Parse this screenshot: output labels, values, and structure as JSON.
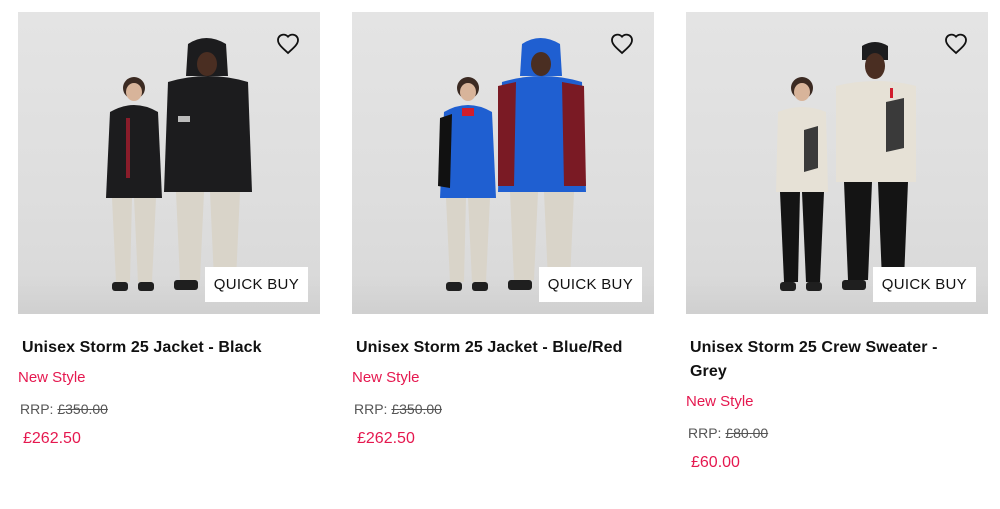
{
  "products": [
    {
      "name": "Unisex Storm 25 Jacket - Black",
      "badge": "New Style",
      "rrp_label": "RRP:",
      "rrp_price": "£350.00",
      "price": "£262.50",
      "quick_buy_label": "QUICK BUY",
      "wishlist_icon": "heart-outline-icon",
      "colors": {
        "jacket": "#1c1c1e",
        "accent": "#8a1c2a",
        "pants": "#d9d4c9",
        "top": "#1c1c1e"
      }
    },
    {
      "name": "Unisex Storm 25 Jacket - Blue/Red",
      "badge": "New Style",
      "rrp_label": "RRP:",
      "rrp_price": "£350.00",
      "price": "£262.50",
      "quick_buy_label": "QUICK BUY",
      "wishlist_icon": "heart-outline-icon",
      "colors": {
        "jacket": "#1f5fd1",
        "accent": "#7a1a24",
        "pants": "#d9d4c9",
        "top": "#1f5fd1"
      }
    },
    {
      "name": "Unisex Storm 25 Crew Sweater - Grey",
      "badge": "New Style",
      "rrp_label": "RRP:",
      "rrp_price": "£80.00",
      "price": "£60.00",
      "quick_buy_label": "QUICK BUY",
      "wishlist_icon": "heart-outline-icon",
      "colors": {
        "jacket": "#e6e1d6",
        "accent": "#3a3a3a",
        "pants": "#141414",
        "top": "#e6e1d6"
      }
    }
  ],
  "theme": {
    "sale_color": "#e5184f",
    "text_color": "#111111"
  }
}
